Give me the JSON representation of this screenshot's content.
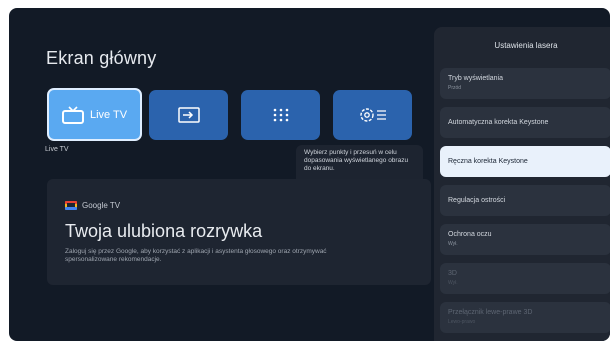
{
  "home": {
    "title": "Ekran główny",
    "tiles": [
      {
        "label": "Live TV",
        "icon": "tv-icon",
        "focused": true
      },
      {
        "label": "",
        "icon": "input-source-icon"
      },
      {
        "label": "",
        "icon": "apps-grid-icon"
      },
      {
        "label": "",
        "icon": "settings-gear-icon"
      }
    ],
    "focused_caption": "Live TV",
    "tooltip": "Wybierz punkty i przesuń w celu dopasowania wyświetlanego obrazu do ekranu."
  },
  "card": {
    "brand": "Google TV",
    "title": "Twoja ulubiona rozrywka",
    "description": "Zaloguj się przez Google, aby korzystać z aplikacji i asystenta głosowego oraz otrzymywać spersonalizowane rekomendacje."
  },
  "panel": {
    "title": "Ustawienia lasera",
    "items": [
      {
        "label": "Tryb wyświetlania",
        "value": "Przód"
      },
      {
        "label": "Automatyczna korekta Keystone",
        "value": ""
      },
      {
        "label": "Ręczna korekta Keystone",
        "value": "",
        "selected": true
      },
      {
        "label": "Regulacja ostrości",
        "value": ""
      },
      {
        "label": "Ochrona oczu",
        "value": "Wył."
      },
      {
        "label": "3D",
        "value": "Wył.",
        "disabled": true
      },
      {
        "label": "Przełącznik lewe-prawe 3D",
        "value": "Lewo-prawo",
        "disabled": true
      }
    ]
  },
  "colors": {
    "background": "#121a26",
    "tile": "#2b63ad",
    "tile_focused": "#5aa9f1",
    "panel": "#202631"
  }
}
